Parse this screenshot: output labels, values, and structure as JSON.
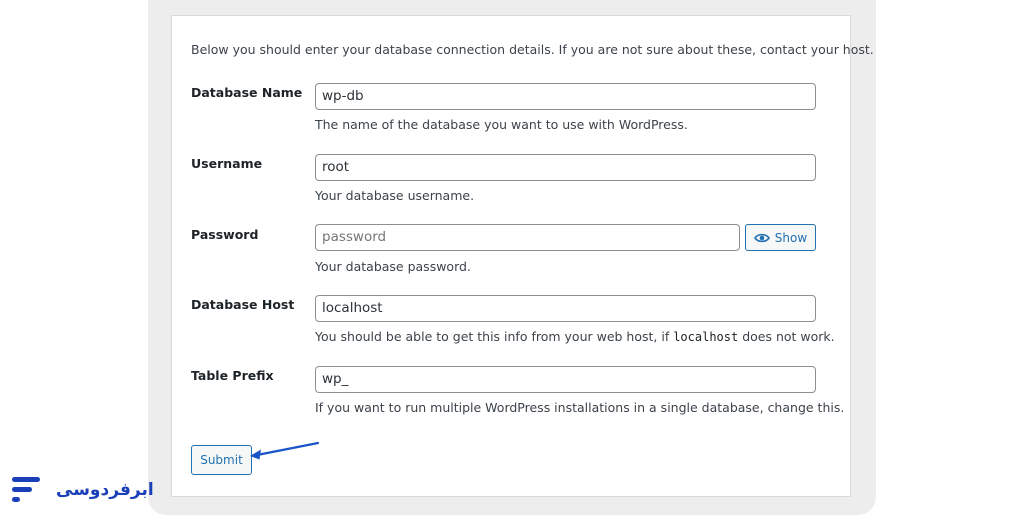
{
  "intro": "Below you should enter your database connection details. If you are not sure about these, contact your host.",
  "fields": [
    {
      "label": "Database Name",
      "value": "wp-db",
      "help": "The name of the database you want to use with WordPress."
    },
    {
      "label": "Username",
      "value": "root",
      "help": "Your database username."
    },
    {
      "label": "Password",
      "placeholder": "password",
      "help": "Your database password.",
      "show_label": "Show"
    },
    {
      "label": "Database Host",
      "value": "localhost",
      "help_before": "You should be able to get this info from your web host, if ",
      "help_code": "localhost",
      "help_after": " does not work."
    },
    {
      "label": "Table Prefix",
      "value": "wp_",
      "help": "If you want to run multiple WordPress installations in a single database, change this."
    }
  ],
  "submit_label": "Submit",
  "logo_text": "ابرفردوسی",
  "colors": {
    "accent": "#2271b1",
    "arrow": "#1a55c8",
    "brand": "#1a3fb8"
  },
  "icons": {
    "show": "eye-icon",
    "annotation": "arrow-icon",
    "logo": "brand-logo-icon"
  }
}
